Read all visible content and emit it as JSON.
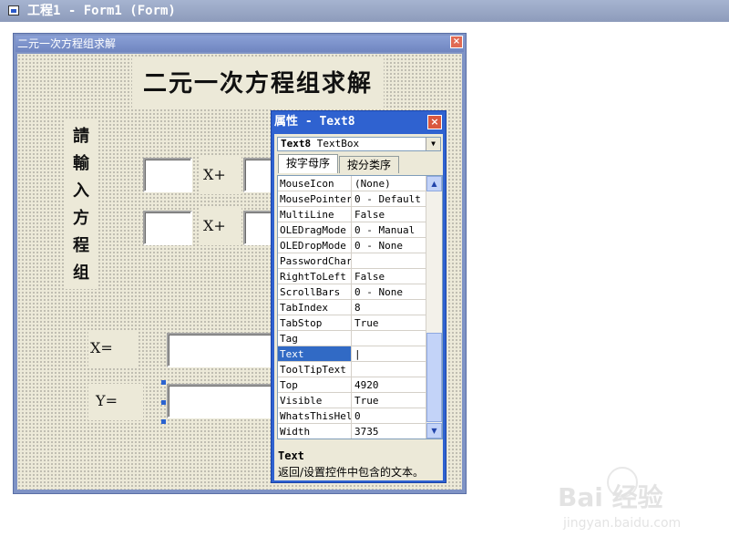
{
  "outer_window": {
    "title": "工程1 - Form1 (Form)"
  },
  "form": {
    "title": "二元一次方程组求解",
    "close_glyph": "×",
    "heading": "二元一次方程组求解",
    "vertical_chars": [
      "請",
      "輸",
      "入",
      "方",
      "程",
      "组"
    ],
    "x_plus_1": "X+",
    "x_plus_2": "X+",
    "x_label": "X=",
    "y_label": "Y="
  },
  "properties": {
    "title": "属性 - Text8",
    "close_glyph": "×",
    "object_name": "Text8",
    "object_type": "TextBox",
    "tabs": [
      "按字母序",
      "按分类序"
    ],
    "rows": [
      {
        "name": "MouseIcon",
        "value": "(None)"
      },
      {
        "name": "MousePointer",
        "value": "0 - Default"
      },
      {
        "name": "MultiLine",
        "value": "False"
      },
      {
        "name": "OLEDragMode",
        "value": "0 - Manual"
      },
      {
        "name": "OLEDropMode",
        "value": "0 - None"
      },
      {
        "name": "PasswordChar",
        "value": ""
      },
      {
        "name": "RightToLeft",
        "value": "False"
      },
      {
        "name": "ScrollBars",
        "value": "0 - None"
      },
      {
        "name": "TabIndex",
        "value": "8"
      },
      {
        "name": "TabStop",
        "value": "True"
      },
      {
        "name": "Tag",
        "value": ""
      },
      {
        "name": "Text",
        "value": "|"
      },
      {
        "name": "ToolTipText",
        "value": ""
      },
      {
        "name": "Top",
        "value": "4920"
      },
      {
        "name": "Visible",
        "value": "True"
      },
      {
        "name": "WhatsThisHelp",
        "value": "0"
      },
      {
        "name": "Width",
        "value": "3735"
      }
    ],
    "selected_property": "Text",
    "description_title": "Text",
    "description_text": "返回/设置控件中包含的文本。"
  },
  "watermark": {
    "logo": "Bai 经验",
    "url": "jingyan.baidu.com"
  },
  "icons": {
    "window": "window-icon",
    "close": "close-icon",
    "dropdown": "chevron-down-icon",
    "scroll_up": "scroll-up-icon",
    "scroll_down": "scroll-down-icon"
  },
  "colors": {
    "props_title": "#2f62d0",
    "form_title": "#7f93c5",
    "selection": "#316ac5",
    "face": "#ece9d8"
  }
}
